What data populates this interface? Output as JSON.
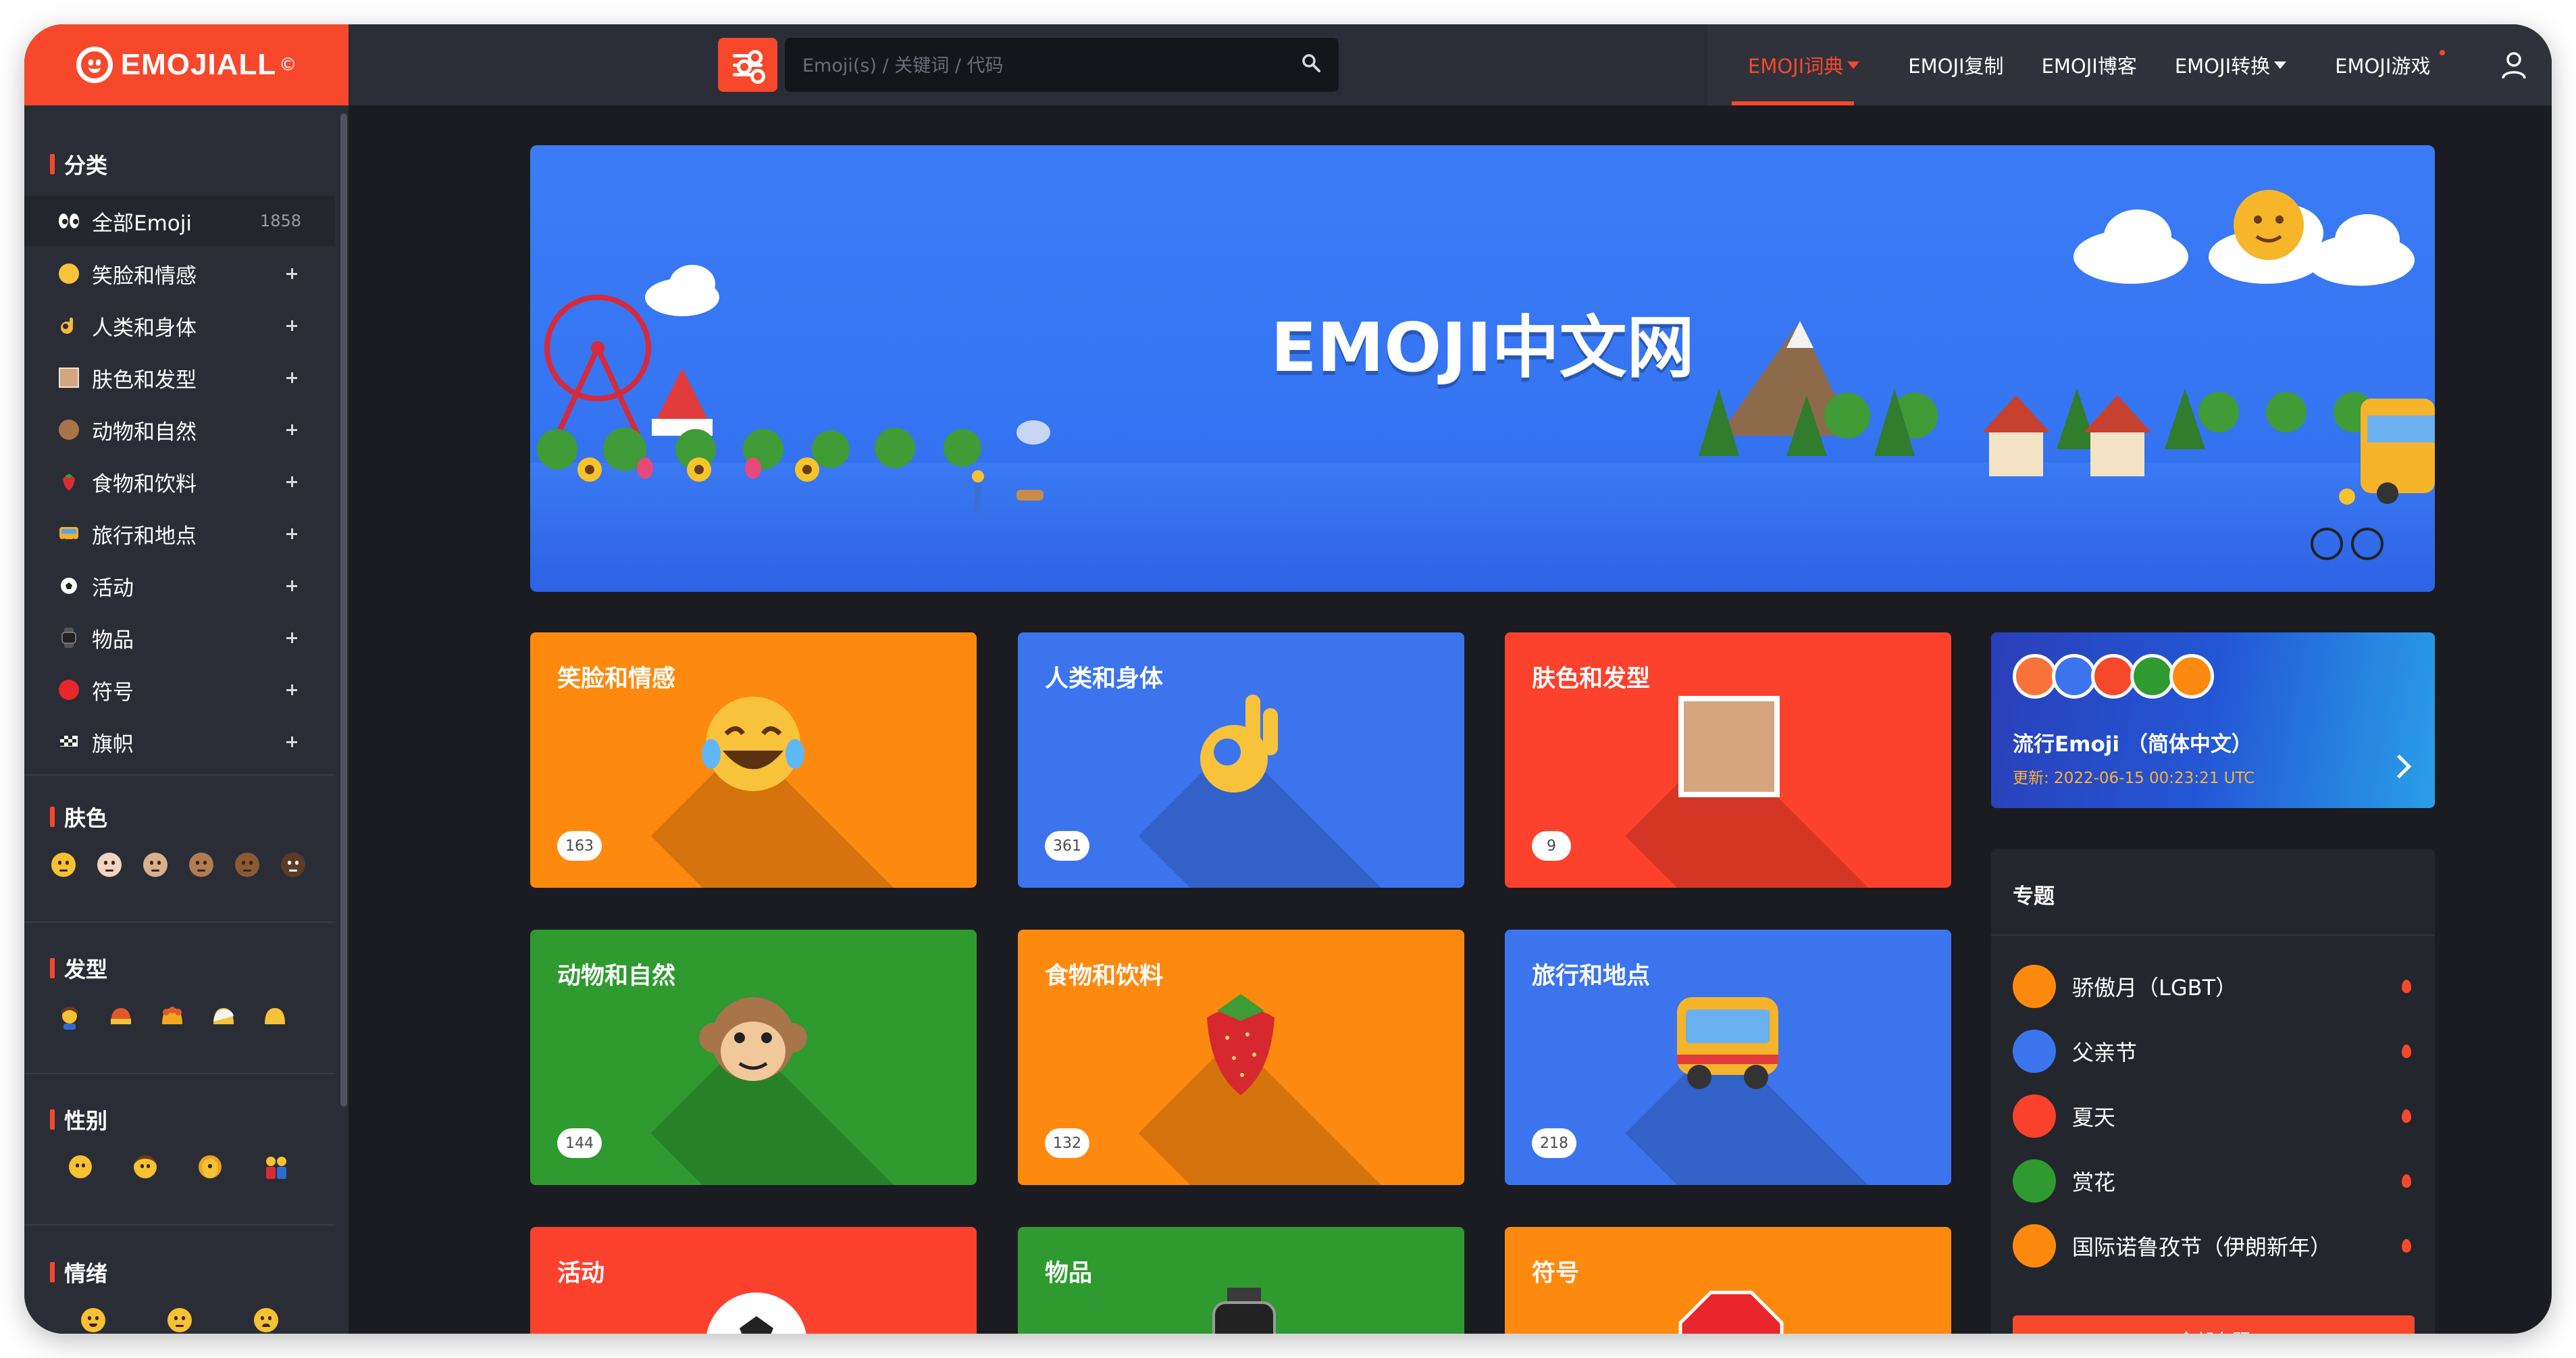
{
  "header": {
    "logo_text": "EMOJIALL",
    "logo_mark": "©",
    "search_placeholder": "Emoji(s) / 关键词 / 代码",
    "nav": [
      {
        "label": "EMOJI词典",
        "active": true,
        "dropdown": true
      },
      {
        "label": "EMOJI复制"
      },
      {
        "label": "EMOJI博客"
      },
      {
        "label": "EMOJI转换",
        "dropdown": true
      },
      {
        "label": "EMOJI游戏",
        "badge_dot": true
      }
    ]
  },
  "sidebar": {
    "category_heading": "分类",
    "items": [
      {
        "label": "全部Emoji",
        "count": "1858",
        "icon": "eyes-icon"
      },
      {
        "label": "笑脸和情感",
        "icon": "laughing-face-icon"
      },
      {
        "label": "人类和身体",
        "icon": "ok-hand-icon"
      },
      {
        "label": "肤色和发型",
        "icon": "skin-swatch-icon"
      },
      {
        "label": "动物和自然",
        "icon": "monkey-icon"
      },
      {
        "label": "食物和饮料",
        "icon": "strawberry-icon"
      },
      {
        "label": "旅行和地点",
        "icon": "bus-icon"
      },
      {
        "label": "活动",
        "icon": "soccer-ball-icon"
      },
      {
        "label": "物品",
        "icon": "watch-icon"
      },
      {
        "label": "符号",
        "icon": "red-circle-icon"
      },
      {
        "label": "旗帜",
        "icon": "checkered-flag-icon"
      }
    ],
    "skin_heading": "肤色",
    "hair_heading": "发型",
    "gender_heading": "性别",
    "mood_heading": "情绪"
  },
  "banner": {
    "title": "EMOJI中文网"
  },
  "cards": [
    {
      "label": "笑脸和情感",
      "count": "163",
      "color": "#fd8a0f",
      "icon": "laughing-face-icon"
    },
    {
      "label": "人类和身体",
      "count": "361",
      "color": "#3c74ed",
      "icon": "ok-hand-icon"
    },
    {
      "label": "肤色和发型",
      "count": "9",
      "color": "#fc412c",
      "icon": "skin-swatch-icon"
    },
    {
      "label": "动物和自然",
      "count": "144",
      "color": "#2e9a2f",
      "icon": "monkey-icon"
    },
    {
      "label": "食物和饮料",
      "count": "132",
      "color": "#fd8a0f",
      "icon": "strawberry-icon"
    },
    {
      "label": "旅行和地点",
      "count": "218",
      "color": "#3c74ed",
      "icon": "bus-icon"
    },
    {
      "label": "活动",
      "color": "#fc412c",
      "icon": "soccer-ball-icon"
    },
    {
      "label": "物品",
      "color": "#2e9a2f",
      "icon": "watch-icon"
    },
    {
      "label": "符号",
      "color": "#fd8a0f",
      "icon": "stop-sign-icon"
    }
  ],
  "trending": {
    "title": "流行Emoji （简体中文）",
    "updated": "更新: 2022-06-15 00:23:21 UTC"
  },
  "topics": {
    "heading": "专题",
    "items": [
      {
        "label": "骄傲月（LGBT）",
        "color": "#fd8a0f"
      },
      {
        "label": "父亲节",
        "color": "#3c74ed"
      },
      {
        "label": "夏天",
        "color": "#fc412c"
      },
      {
        "label": "赏花",
        "color": "#2e9a2f"
      },
      {
        "label": "国际诺鲁孜节（伊朗新年）",
        "color": "#fd8a0f"
      }
    ],
    "all_button": "全部专题"
  },
  "colors": {
    "accent": "#f7482b",
    "header": "#2b2d36",
    "page": "#1b1c21"
  }
}
